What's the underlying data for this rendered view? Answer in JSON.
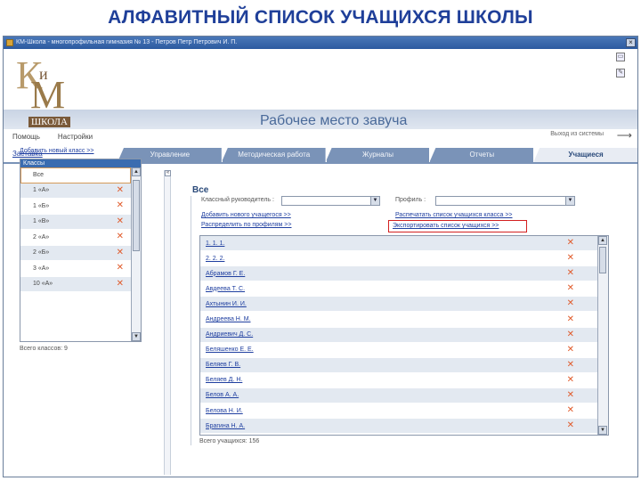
{
  "slide_title": "АЛФАВИТНЫЙ СПИСОК УЧАЩИХСЯ ШКОЛЫ",
  "window": {
    "title": "КМ-Школа - многопрофильная гимназия № 13 - Петров Петр Петрович И. П.",
    "close_glyph": "×"
  },
  "logo": {
    "k": "К",
    "i": "и",
    "m": "М",
    "school": "ШКОЛА"
  },
  "banner_title": "Рабочее место завуча",
  "tool_icons": [
    {
      "name": "print-icon",
      "glyph": "▭"
    },
    {
      "name": "edit-icon",
      "glyph": "✎"
    }
  ],
  "top_links": [
    "Помощь",
    "Настройки"
  ],
  "exit_label": "Выход из системы",
  "exit_arrow": "⟶",
  "left_tab_link": "Заставка",
  "tabs": [
    {
      "label": "Управление",
      "active": false
    },
    {
      "label": "Методическая работа",
      "active": false
    },
    {
      "label": "Журналы",
      "active": false
    },
    {
      "label": "Отчеты",
      "active": false
    },
    {
      "label": "Учащиеся",
      "active": true
    }
  ],
  "splitter_glyph": "«",
  "left_panel": {
    "add_class_link": "Добавить новый класс >>",
    "header": "Классы",
    "classes": [
      {
        "name": "Все",
        "deletable": false
      },
      {
        "name": "1 «А»",
        "deletable": true
      },
      {
        "name": "1 «Б»",
        "deletable": true
      },
      {
        "name": "1 «В»",
        "deletable": true
      },
      {
        "name": "2 «А»",
        "deletable": true
      },
      {
        "name": "2 «Б»",
        "deletable": true
      },
      {
        "name": "3 «А»",
        "deletable": true
      },
      {
        "name": "10 «А»",
        "deletable": true
      }
    ],
    "count_label": "Всего классов: 9"
  },
  "delete_glyph": "✕",
  "scroll_up": "▲",
  "scroll_down": "▼",
  "right_panel": {
    "title": "Все",
    "class_teacher_label": "Классный руководитель :",
    "class_teacher_value": "",
    "profile_label": "Профиль :",
    "profile_value": "",
    "select_arrow": "▼",
    "links": {
      "add_student": "Добавить нового учащегося >>",
      "distribute": "Распределить по профилям >>",
      "print_list": "Распечатать список учащихся класса >>",
      "export_list": "Экспортировать список учащихся >>"
    },
    "students": [
      "1. 1. 1.",
      "2. 2. 2.",
      "Абрамов Г. Е.",
      "Авдеева Т. С.",
      "Ахтынин И. И.",
      "Андреева Н. М.",
      "Андриевич Д. С.",
      "Беляшенко Е. Е.",
      "Беляев Г. В.",
      "Беляев Д. Н.",
      "Белов А. А.",
      "Белова Н. И.",
      "Брагина Н. А."
    ],
    "count_label": "Всего учащихся: 156"
  }
}
